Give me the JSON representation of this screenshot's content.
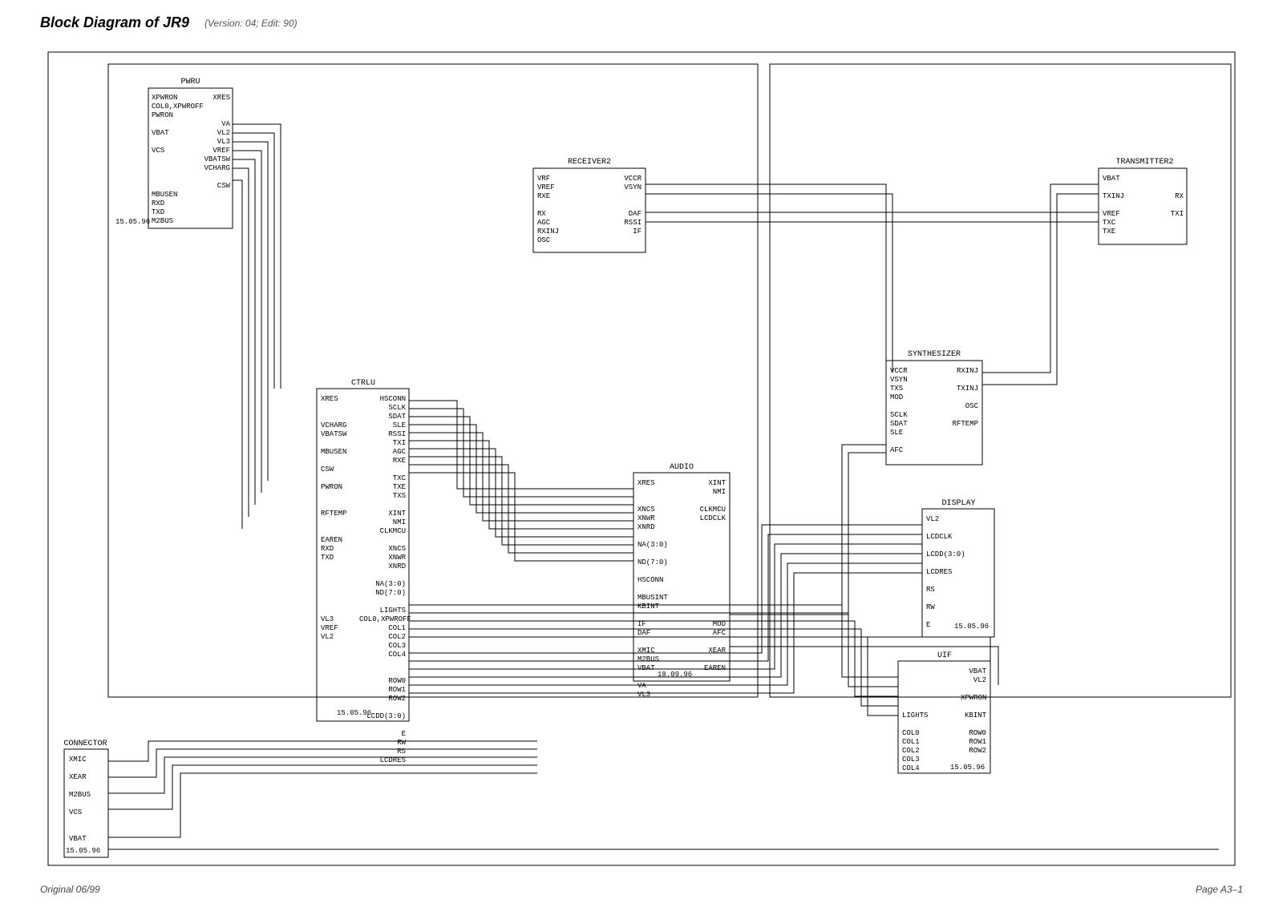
{
  "header": {
    "title": "Block Diagram of JR9",
    "subtitle": "(Version: 04; Edit: 90)"
  },
  "footer": {
    "left": "Original 06/99",
    "right": "Page A3–1"
  },
  "dates": {
    "d1": "15.05.96",
    "d2": "18.09.96"
  },
  "blocks": {
    "pwru": {
      "title": "PWRU",
      "left": [
        "XPWRON",
        "COL0,XPWROFF",
        "PWRON",
        "",
        "VBAT",
        "",
        "VCS",
        "",
        "",
        "",
        "",
        "MBUSEN",
        "RXD",
        "TXD",
        "M2BUS"
      ],
      "right": [
        "XRES",
        "",
        "",
        "VA",
        "VL2",
        "VL3",
        "VREF",
        "VBATSW",
        "VCHARG",
        "",
        "CSW",
        "",
        "",
        "",
        ""
      ]
    },
    "receiver2": {
      "title": "RECEIVER2",
      "left": [
        "VRF",
        "VREF",
        "RXE",
        "",
        "RX",
        "AGC",
        "RXINJ",
        "OSC"
      ],
      "right": [
        "VCCR",
        "VSYN",
        "",
        "",
        "DAF",
        "RSSI",
        "IF",
        ""
      ]
    },
    "transmitter2": {
      "title": "TRANSMITTER2",
      "left": [
        "VBAT",
        "",
        "TXINJ",
        "",
        "VREF",
        "TXC",
        "TXE"
      ],
      "right": [
        "",
        "",
        "RX",
        "",
        "TXI",
        "",
        ""
      ]
    },
    "synthesizer": {
      "title": "SYNTHESIZER",
      "left": [
        "VCCR",
        "VSYN",
        "TXS",
        "MOD",
        "",
        "SCLK",
        "SDAT",
        "SLE",
        "",
        "AFC"
      ],
      "right": [
        "RXINJ",
        "",
        "TXINJ",
        "",
        "OSC",
        "",
        "RFTEMP",
        "",
        "",
        ""
      ]
    },
    "ctrlu": {
      "title": "CTRLU",
      "left": [
        "XRES",
        "",
        "",
        "VCHARG",
        "VBATSW",
        "",
        "MBUSEN",
        "",
        "CSW",
        "",
        "PWRON",
        "",
        "",
        "RFTEMP",
        "",
        "",
        "EAREN",
        "RXD",
        "TXD",
        "",
        "",
        "",
        "",
        "",
        "",
        "VL3",
        "VREF",
        "VL2",
        "",
        "",
        "",
        "",
        "",
        "",
        ""
      ],
      "right": [
        "HSCONN",
        "SCLK",
        "SDAT",
        "SLE",
        "RSSI",
        "TXI",
        "AGC",
        "RXE",
        "",
        "TXC",
        "TXE",
        "TXS",
        "",
        "XINT",
        "NMI",
        "CLKMCU",
        "",
        "XNCS",
        "XNWR",
        "XNRD",
        "",
        "NA(3:0)",
        "ND(7:0)",
        "",
        "LIGHTS",
        "COL0,XPWROFF",
        "COL1",
        "COL2",
        "COL3",
        "COL4",
        "",
        "",
        "ROW0",
        "ROW1",
        "ROW2",
        "",
        "LCDD(3:0)",
        "",
        "E",
        "RW",
        "RS",
        "LCDRES"
      ]
    },
    "audio": {
      "title": "AUDIO",
      "left": [
        "XRES",
        "",
        "",
        "XNCS",
        "XNWR",
        "XNRD",
        "",
        "NA(3:0)",
        "",
        "ND(7:0)",
        "",
        "HSCONN",
        "",
        "MBUSINT",
        "KBINT",
        "",
        "IF",
        "DAF",
        "",
        "XMIC",
        "M2BUS",
        "VBAT",
        "",
        "VA",
        "VL3"
      ],
      "right": [
        "XINT",
        "NMI",
        "",
        "CLKMCU",
        "LCDCLK",
        "",
        "",
        "",
        "",
        "",
        "",
        "",
        "",
        "",
        "",
        "",
        "MOD",
        "AFC",
        "",
        "XEAR",
        "",
        "EAREN",
        "",
        "",
        ""
      ]
    },
    "display": {
      "title": "DISPLAY",
      "left": [
        "VL2",
        "",
        "LCDCLK",
        "",
        "LCDD(3:0)",
        "",
        "LCDRES",
        "",
        "RS",
        "",
        "RW",
        "",
        "E"
      ],
      "right": [
        "",
        "",
        "",
        "",
        "",
        "",
        "",
        "",
        "",
        "",
        "",
        "",
        ""
      ]
    },
    "uif": {
      "title": "UIF",
      "left": [
        "",
        "",
        "",
        "",
        "",
        "LIGHTS",
        "",
        "COL0",
        "COL1",
        "COL2",
        "COL3",
        "COL4"
      ],
      "right": [
        "VBAT",
        "VL2",
        "",
        "XPWRON",
        "",
        "KBINT",
        "",
        "ROW0",
        "ROW1",
        "ROW2",
        "",
        ""
      ]
    },
    "connector": {
      "title": "CONNECTOR",
      "left": [
        "XMIC",
        "",
        "XEAR",
        "",
        "M2BUS",
        "",
        "VCS",
        "",
        "",
        "VBAT"
      ],
      "right": []
    }
  }
}
